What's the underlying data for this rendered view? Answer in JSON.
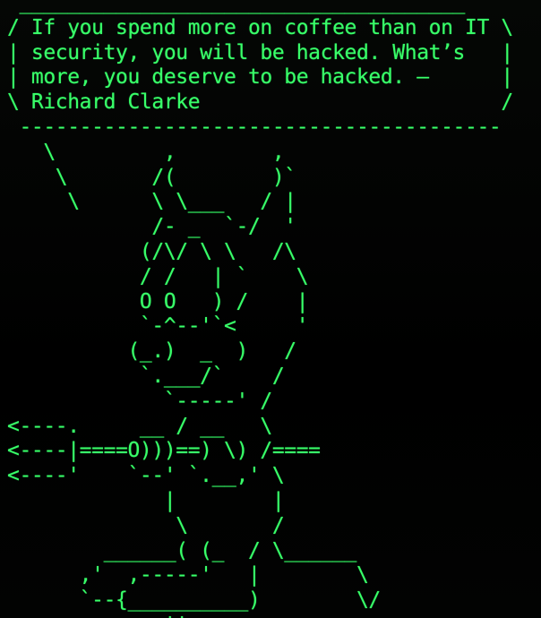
{
  "terminal": {
    "colors": {
      "foreground": "#39ff6a",
      "background": "#000000"
    },
    "cowsay_output": " _____________________________________\n/ If you spend more on coffee than on IT \\\n| security, you will be hacked. What’s   |\n| more, you deserve to be hacked. –      |\n\\ Richard Clarke                         /\n ----------------------------------------\n   \\         ,        ,\n    \\       /(        )`\n     \\      \\ \\___   / |\n            /- _  `-/  '\n           (/\\/ \\ \\   /\\\n           / /   | `    \\\n           O O   ) /    |\n           `-^--'`<     '\n          (_.)  _  )   /\n           `.___/`    /\n             `-----' /\n<----.     __ / __   \\\n<----|====O)))==) \\) /====\n<----'    `--' `.__,' \\\n             |        |\n              \\       /\n        ______( (_  / \\______\n      ,'  ,-----'   |        \\\n      `--{__________)        \\/\n             ''"
  }
}
